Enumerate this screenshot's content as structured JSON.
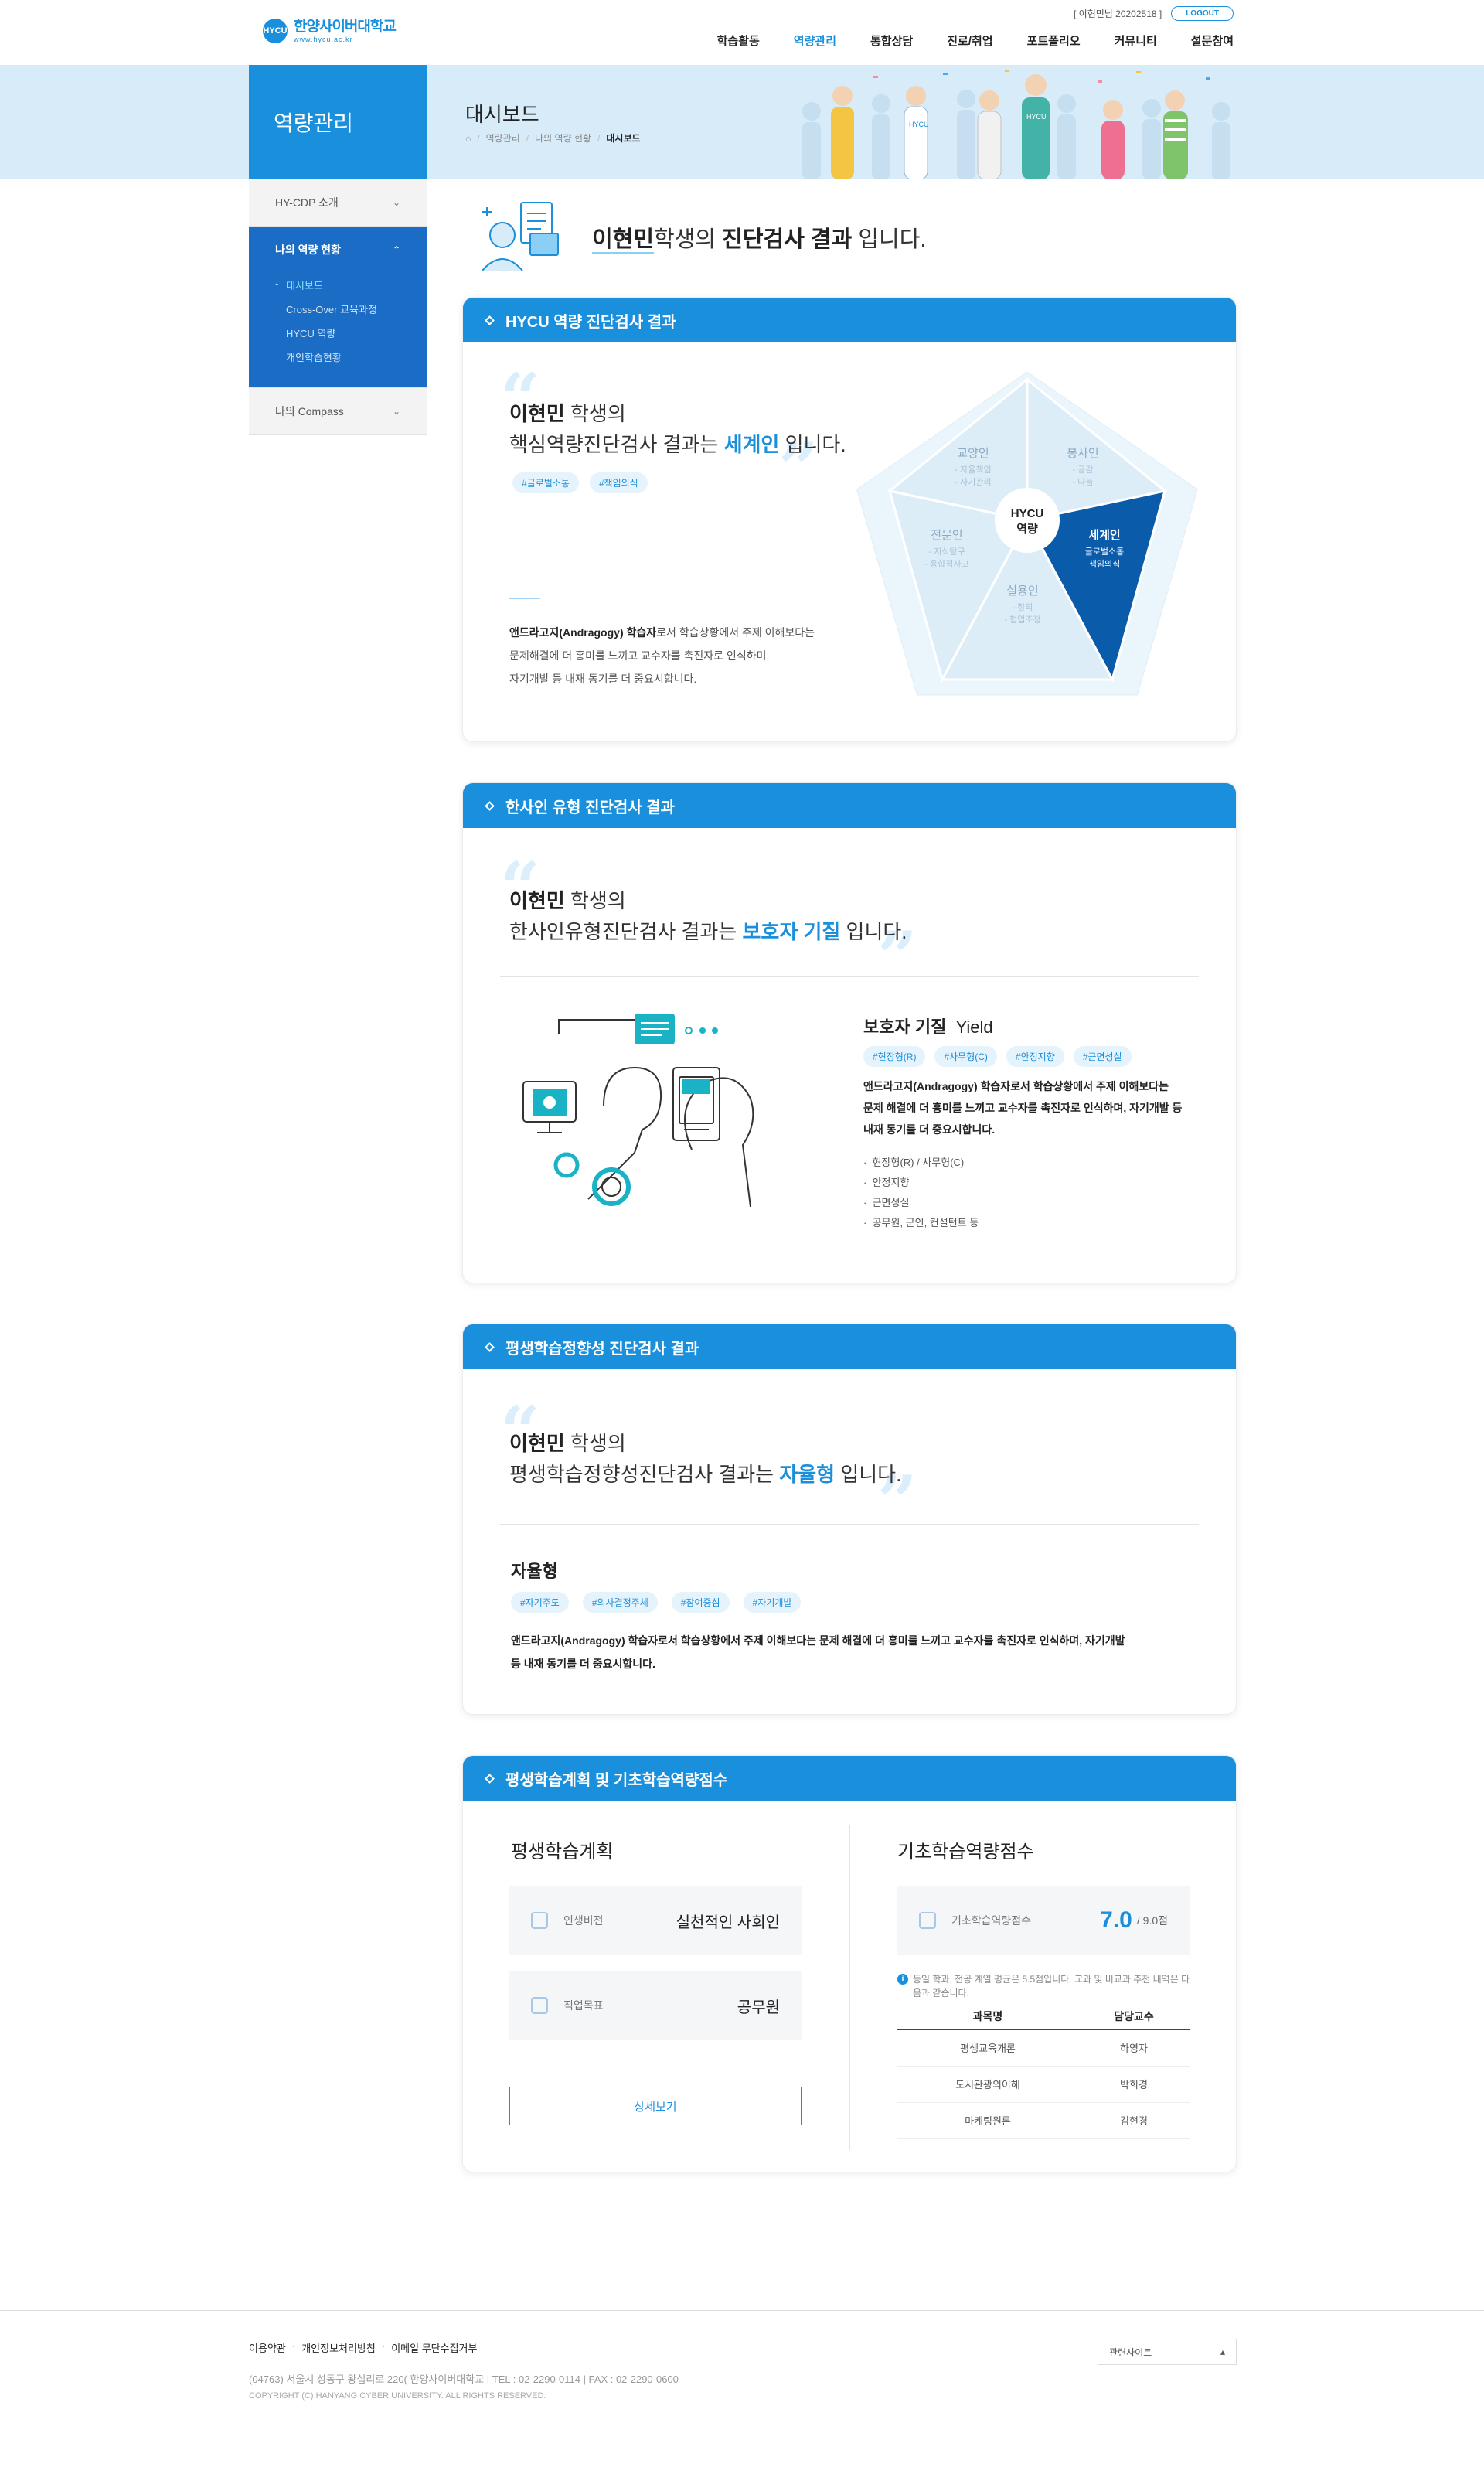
{
  "header": {
    "logo_mark": "HYCU",
    "logo_name": "한양사이버대학교",
    "logo_url": "www.hycu.ac.kr",
    "user_info": "[ 이현민님 20202518 ]",
    "logout": "LOGOUT",
    "gnb": [
      "학습활동",
      "역량관리",
      "통합상담",
      "진로/취업",
      "포트폴리오",
      "커뮤니티",
      "설문참여"
    ],
    "active_gnb": "역량관리"
  },
  "subvisual": {
    "section_title": "역량관리",
    "page_title": "대시보드",
    "breadcrumb": [
      "역량관리",
      "나의 역량 현황",
      "대시보드"
    ]
  },
  "lnb": {
    "groups": [
      {
        "label": "HY-CDP 소개",
        "open": false
      },
      {
        "label": "나의 역량 현황",
        "open": true,
        "items": [
          "대시보드",
          "Cross-Over 교육과정",
          "HYCU 역량",
          "개인학습현황"
        ],
        "active": "대시보드"
      },
      {
        "label": "나의 Compass",
        "open": false
      }
    ]
  },
  "intro": {
    "name": "이현민",
    "mid": "학생의 ",
    "bold": "진단검사 결과",
    "end": " 입니다."
  },
  "card1": {
    "title": "HYCU 역량 진단검사 결과",
    "name": "이현민",
    "name_suffix": " 학생의",
    "line_prefix": "핵심역량진단검사 결과는 ",
    "result": "세계인",
    "line_suffix": " 입니다.",
    "tags": [
      "#글로벌소통",
      "#책임의식"
    ],
    "desc_bold": "앤드라고지(Andragogy) 학습자",
    "desc_1": "로서 학습상황에서 주제 이해보다는",
    "desc_2": "문제해결에 더 흥미를 느끼고 교수자를 촉진자로 인식하며,",
    "desc_3": "자기개발 등 내재 동기를 더 중요시합니다.",
    "pentagon": {
      "center_1": "HYCU",
      "center_2": "역량",
      "segments": [
        {
          "title": "교양인",
          "items": [
            "- 자율책임",
            "- 자기관리"
          ]
        },
        {
          "title": "봉사인",
          "items": [
            "- 공감",
            "- 나눔"
          ]
        },
        {
          "title": "세계인",
          "items": [
            "글로벌소통",
            "책임의식"
          ],
          "highlight": true
        },
        {
          "title": "실용인",
          "items": [
            "- 창의",
            "- 협업조정"
          ]
        },
        {
          "title": "전문인",
          "items": [
            "- 지식탐구",
            "- 융합적사고"
          ]
        }
      ]
    }
  },
  "card2": {
    "title": "한사인 유형 진단검사 결과",
    "name": "이현민",
    "name_suffix": " 학생의",
    "line_prefix": "한사인유형진단검사 결과는 ",
    "result": "보호자 기질",
    "line_suffix": " 입니다.",
    "type_title": "보호자 기질",
    "type_en": "Yield",
    "tags": [
      "#현장형(R)",
      "#사무형(C)",
      "#안정지향",
      "#근면성실"
    ],
    "desc": [
      "앤드라고지(Andragogy) 학습자로서 학습상황에서 주제 이해보다는",
      "문제 해결에 더 흥미를 느끼고 교수자를 촉진자로 인식하며, 자기개발 등",
      "내재 동기를 더 중요시합니다."
    ],
    "bullets": [
      "현장형(R) / 사무형(C)",
      "안정지향",
      "근면성실",
      "공무원, 군인, 컨설턴트 등"
    ]
  },
  "card3": {
    "title": "평생학습정향성 진단검사 결과",
    "name": "이현민",
    "name_suffix": " 학생의",
    "line_prefix": "평생학습정향성진단검사 결과는 ",
    "result": "자율형",
    "line_suffix": " 입니다.",
    "type_title": "자율형",
    "tags": [
      "#자기주도",
      "#의사결정주체",
      "#참여중심",
      "#자기개발"
    ],
    "desc": [
      "앤드라고지(Andragogy) 학습자로서 학습상황에서 주제 이해보다는 문제 해결에 더 흥미를 느끼고 교수자를 촉진자로 인식하며, 자기개발",
      "등 내재 동기를 더 중요시합니다."
    ]
  },
  "card4": {
    "title": "평생학습계획 및 기초학습역량점수",
    "plan_title": "평생학습계획",
    "plan_rows": [
      {
        "label": "인생비전",
        "value": "실천적인 사회인"
      },
      {
        "label": "직업목표",
        "value": "공무원"
      }
    ],
    "detail_btn": "상세보기",
    "score_title": "기초학습역량점수",
    "score_label": "기초학습역량점수",
    "score_value": "7.0",
    "score_max": "/ 9.0점",
    "notice": "동일 학과, 전공 계열 평균은 5.5점입니다. 교과 및 비교과 추천 내역은 다음과 같습니다.",
    "table_headers": [
      "과목명",
      "담당교수"
    ],
    "table_rows": [
      [
        "평생교육개론",
        "하영자"
      ],
      [
        "도시관광의이해",
        "박희경"
      ],
      [
        "마케팅원론",
        "김현경"
      ]
    ]
  },
  "footer": {
    "links": [
      "이용약관",
      "개인정보처리방침",
      "이메일 무단수집거부"
    ],
    "address": "(04763) 서울시 성동구 왕십리로 220(  한양사이버대학교  |  TEL : 02-2290-0114  |  FAX : 02-2290-0600",
    "copyright": "COPYRIGHT (C) HANYANG CYBER UNIVERSITY.  ALL RIGHTS RESERVED.",
    "family_site": "관련사이트"
  },
  "colors": {
    "primary": "#1a8fdc",
    "dark_blue": "#1a6cc4",
    "light_blue": "#d7ebf9",
    "highlight_segment": "#0b5bab"
  }
}
